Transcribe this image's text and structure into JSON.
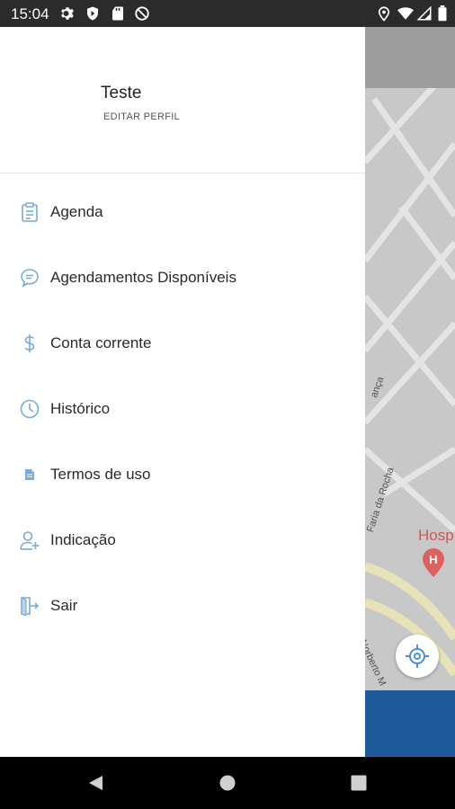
{
  "status_bar": {
    "time": "15:04",
    "left_icons": [
      "gear-icon",
      "shield-icon",
      "sd-card-icon",
      "blocked-icon"
    ],
    "right_icons": [
      "location-icon",
      "wifi-icon",
      "signal-icon",
      "battery-icon"
    ]
  },
  "drawer": {
    "user_name": "Teste",
    "edit_profile": "EDITAR PERFIL",
    "items": [
      {
        "label": "Agenda",
        "icon": "clipboard-icon"
      },
      {
        "label": "Agendamentos Disponíveis",
        "icon": "chat-icon"
      },
      {
        "label": "Conta corrente",
        "icon": "dollar-icon"
      },
      {
        "label": "Histórico",
        "icon": "clock-icon"
      },
      {
        "label": "Termos de uso",
        "icon": "document-icon"
      },
      {
        "label": "Indicação",
        "icon": "add-user-icon"
      },
      {
        "label": "Sair",
        "icon": "exit-icon"
      }
    ]
  },
  "map": {
    "street_labels": [
      "ança",
      "Faria da Rocha",
      "Norberto M"
    ],
    "place_label": "Hosp",
    "place_icon": "hospital-pin-icon",
    "locate_icon": "crosshair-icon"
  },
  "nav_bar": {
    "buttons": [
      "back-icon",
      "home-icon",
      "recents-icon"
    ]
  },
  "colors": {
    "accent": "#4a90d9",
    "map_background": "#c8c8c8",
    "map_bottom_bar": "#1f5b9a",
    "status_bar": "#2b2b2b"
  }
}
